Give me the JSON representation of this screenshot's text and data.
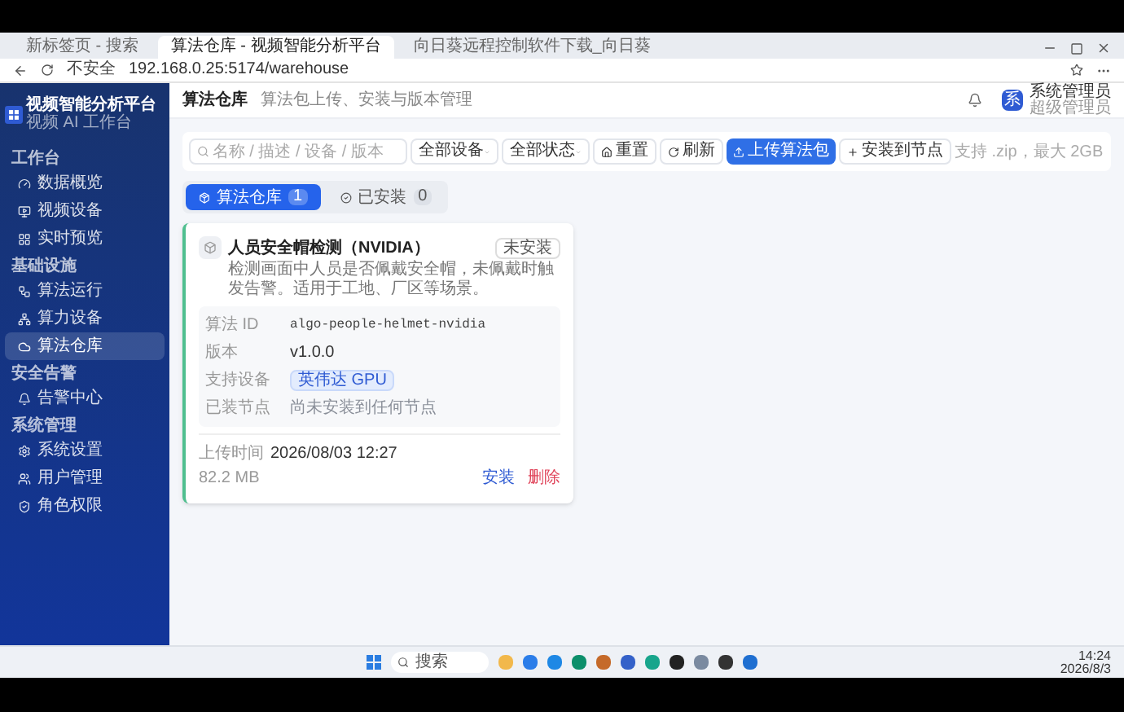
{
  "browser": {
    "tabs": [
      {
        "title": "新标签页 - 搜索",
        "selected": false
      },
      {
        "title": "算法仓库 - 视频智能分析平台",
        "selected": true
      },
      {
        "title": "向日葵远程控制软件下载_向日葵",
        "selected": false
      }
    ],
    "security": "不安全",
    "url": "192.168.0.25:5174/warehouse"
  },
  "sidebar": {
    "title": "视频智能分析平台",
    "subtitle": "视频 AI 工作台",
    "sections": [
      {
        "label": "工作台",
        "items": [
          {
            "label": "数据概览",
            "selected": false
          },
          {
            "label": "视频设备",
            "selected": false
          },
          {
            "label": "实时预览",
            "selected": false
          }
        ]
      },
      {
        "label": "基础设施",
        "items": [
          {
            "label": "算法运行",
            "selected": false
          },
          {
            "label": "算力设备",
            "selected": false
          },
          {
            "label": "算法仓库",
            "selected": true
          }
        ]
      },
      {
        "label": "安全告警",
        "items": [
          {
            "label": "告警中心",
            "selected": false
          }
        ]
      },
      {
        "label": "系统管理",
        "items": [
          {
            "label": "系统设置",
            "selected": false
          },
          {
            "label": "用户管理",
            "selected": false
          },
          {
            "label": "角色权限",
            "selected": false
          }
        ]
      }
    ]
  },
  "header": {
    "title": "算法仓库",
    "subtitle": "算法包上传、安装与版本管理",
    "user_initial": "系",
    "user_name": "系统管理员",
    "user_role": "超级管理员"
  },
  "toolbar": {
    "search_placeholder": "名称 / 描述 / 设备 / 版本",
    "filters": [
      "全部设备",
      "全部状态"
    ],
    "reset": "重置",
    "refresh": "刷新",
    "upload": "上传算法包",
    "install": "安装到节点",
    "hint": "支持 .zip，最大 2GB"
  },
  "tabs": [
    {
      "label": "算法仓库",
      "count": "1",
      "selected": true
    },
    {
      "label": "已安装",
      "count": "0",
      "selected": false
    }
  ],
  "cards": [
    {
      "title": "人员安全帽检测（NVIDIA）",
      "status": "未安装",
      "description": "检测画面中人员是否佩戴安全帽，未佩戴时触发告警。适用于工地、厂区等场景。",
      "fields": [
        {
          "label": "算法 ID",
          "value": "algo-people-helmet-nvidia",
          "kind": "code"
        },
        {
          "label": "版本",
          "value": "v1.0.0",
          "kind": "text"
        },
        {
          "label": "支持设备",
          "value": "英伟达 GPU",
          "kind": "tag"
        },
        {
          "label": "已装节点",
          "value": "尚未安装到任何节点",
          "kind": "muted"
        }
      ],
      "upload_label": "上传时间",
      "upload_time": "2026/08/03 12:27",
      "size": "82.2 MB",
      "actions": [
        "安装",
        "删除"
      ]
    }
  ],
  "taskbar": {
    "search": "搜索",
    "time": "14:24",
    "date": "2026/8/3"
  }
}
